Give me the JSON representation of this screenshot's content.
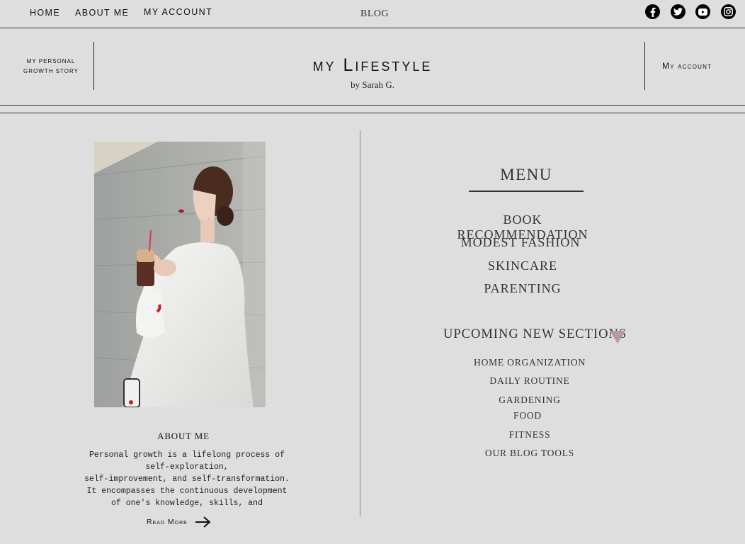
{
  "nav": {
    "links": [
      "HOME",
      "ABOUT ME",
      "MY ACCOUNT"
    ],
    "center": "BLOG"
  },
  "social": [
    "facebook-icon",
    "twitter-icon",
    "youtube-icon",
    "instagram-icon"
  ],
  "header": {
    "left_line1": "my personal",
    "left_line2": "growth story",
    "brand": "my Lifestyle",
    "byline": "by Sarah G.",
    "account": "My account"
  },
  "about": {
    "title": "ABOUT ME",
    "lines": [
      "Personal growth is a lifelong process of",
      "self-exploration,",
      "self-improvement, and self-transformation.",
      "It encompasses the continuous development",
      "of one's knowledge, skills, and"
    ],
    "read_more": "Read More"
  },
  "menu": {
    "title": "MENU",
    "items": [
      "BOOK RECOMMENDATION",
      "MODEST FASHION",
      "SKINCARE",
      "PARENTING"
    ]
  },
  "upcoming": {
    "title": "UPCOMING NEW SECTIONS",
    "items": [
      "HOME ORGANIZATION",
      "DAILY ROUTINE",
      "GARDENING",
      "FOOD",
      "FITNESS",
      "OUR BLOG TOOLS"
    ]
  },
  "colors": {
    "background": "#dedede",
    "triangle": "#b59aa0"
  }
}
